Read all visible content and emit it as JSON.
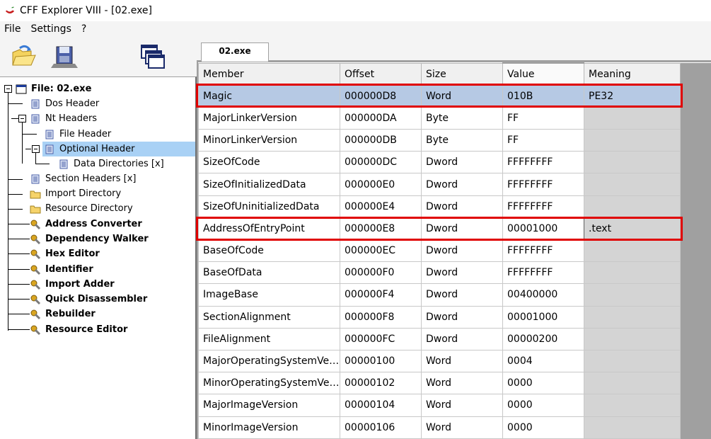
{
  "window": {
    "title": "CFF Explorer VIII - [02.exe]"
  },
  "menu": [
    "File",
    "Settings",
    "?"
  ],
  "toolbar": {
    "buttons": [
      "open-icon",
      "save-icon",
      "windows-icon"
    ]
  },
  "tree": {
    "items": [
      {
        "label": "File: 02.exe",
        "icon": "file-window-icon",
        "bold": true
      },
      {
        "label": "Dos Header",
        "icon": "document-icon"
      },
      {
        "label": "Nt Headers",
        "icon": "document-icon"
      },
      {
        "label": "File Header",
        "icon": "document-icon"
      },
      {
        "label": "Optional Header",
        "icon": "document-icon",
        "selected": true
      },
      {
        "label": "Data Directories [x]",
        "icon": "document-icon"
      },
      {
        "label": "Section Headers [x]",
        "icon": "document-icon"
      },
      {
        "label": "Import Directory",
        "icon": "folder-icon"
      },
      {
        "label": "Resource Directory",
        "icon": "folder-icon"
      },
      {
        "label": "Address Converter",
        "icon": "tool-icon",
        "bold": true
      },
      {
        "label": "Dependency Walker",
        "icon": "tool-icon",
        "bold": true
      },
      {
        "label": "Hex Editor",
        "icon": "tool-icon",
        "bold": true
      },
      {
        "label": "Identifier",
        "icon": "tool-icon",
        "bold": true
      },
      {
        "label": "Import Adder",
        "icon": "tool-icon",
        "bold": true
      },
      {
        "label": "Quick Disassembler",
        "icon": "tool-icon",
        "bold": true
      },
      {
        "label": "Rebuilder",
        "icon": "tool-icon",
        "bold": true
      },
      {
        "label": "Resource Editor",
        "icon": "tool-icon",
        "bold": true
      }
    ]
  },
  "tabs": [
    "02.exe"
  ],
  "table": {
    "headers": [
      "Member",
      "Offset",
      "Size",
      "Value",
      "Meaning"
    ],
    "rows": [
      [
        "Magic",
        "000000D8",
        "Word",
        "010B",
        "PE32"
      ],
      [
        "MajorLinkerVersion",
        "000000DA",
        "Byte",
        "FF",
        ""
      ],
      [
        "MinorLinkerVersion",
        "000000DB",
        "Byte",
        "FF",
        ""
      ],
      [
        "SizeOfCode",
        "000000DC",
        "Dword",
        "FFFFFFFF",
        ""
      ],
      [
        "SizeOfInitializedData",
        "000000E0",
        "Dword",
        "FFFFFFFF",
        ""
      ],
      [
        "SizeOfUninitializedData",
        "000000E4",
        "Dword",
        "FFFFFFFF",
        ""
      ],
      [
        "AddressOfEntryPoint",
        "000000E8",
        "Dword",
        "00001000",
        ".text"
      ],
      [
        "BaseOfCode",
        "000000EC",
        "Dword",
        "FFFFFFFF",
        ""
      ],
      [
        "BaseOfData",
        "000000F0",
        "Dword",
        "FFFFFFFF",
        ""
      ],
      [
        "ImageBase",
        "000000F4",
        "Dword",
        "00400000",
        ""
      ],
      [
        "SectionAlignment",
        "000000F8",
        "Dword",
        "00001000",
        ""
      ],
      [
        "FileAlignment",
        "000000FC",
        "Dword",
        "00000200",
        ""
      ],
      [
        "MajorOperatingSystemVersion",
        "00000100",
        "Word",
        "0004",
        ""
      ],
      [
        "MinorOperatingSystemVersion",
        "00000102",
        "Word",
        "0000",
        ""
      ],
      [
        "MajorImageVersion",
        "00000104",
        "Word",
        "0000",
        ""
      ],
      [
        "MinorImageVersion",
        "00000106",
        "Word",
        "0000",
        ""
      ]
    ]
  },
  "colors": {
    "highlight": "#e00000",
    "selected_row": "#b6c9e4",
    "tree_selected": "#a9d1f5"
  }
}
